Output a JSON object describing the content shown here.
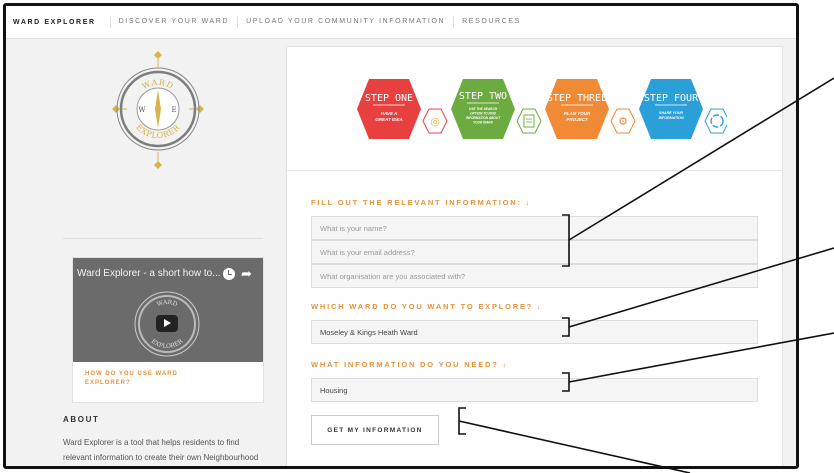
{
  "topnav": {
    "brand": "WARD EXPLORER",
    "links": [
      "DISCOVER YOUR WARD",
      "UPLOAD YOUR COMMUNITY INFORMATION",
      "RESOURCES"
    ]
  },
  "logo": {
    "top_text": "WARD",
    "bottom_text": "EXPLORER",
    "w": "W",
    "e": "E"
  },
  "video": {
    "title": "Ward Explorer - a short how to...",
    "caption": "HOW DO YOU USE WARD EXPLORER?",
    "art_top": "WARD",
    "art_bottom": "EXPLORER"
  },
  "about": {
    "heading": "ABOUT",
    "text": "Ward Explorer is a tool that helps residents to find relevant information to create their own Neighbourhood Plan. The site uses information"
  },
  "steps": [
    {
      "title": "STEP ONE",
      "desc": "HAVE A GREAT IDEA",
      "color": "#e8403f"
    },
    {
      "title": "STEP TWO",
      "desc": "USE THE SEARCH OPTION TO FIND INFORMATION ABOUT YOUR WARD",
      "color": "#6cab3f"
    },
    {
      "title": "STEP THREE",
      "desc": "PLAN YOUR PROJECT",
      "color": "#f08a35"
    },
    {
      "title": "STEP FOUR",
      "desc": "SHARE YOUR INFORMATION",
      "color": "#2a9fd8"
    }
  ],
  "form": {
    "heading1": "FILL OUT THE RELEVANT INFORMATION: ↓",
    "name_placeholder": "What is your name?",
    "email_placeholder": "What is your email address?",
    "org_placeholder": "What organisation are you associated with?",
    "heading2": "WHICH WARD DO YOU WANT TO EXPLORE? ↓",
    "ward_value": "Moseley & Kings Heath Ward",
    "heading3": "WHAT INFORMATION DO YOU NEED? ↓",
    "info_value": "Housing",
    "submit_label": "GET MY INFORMATION"
  },
  "colors": {
    "accent": "#e8923a",
    "logo_gold": "#d9b34a",
    "logo_ring": "#7d7d7d"
  }
}
